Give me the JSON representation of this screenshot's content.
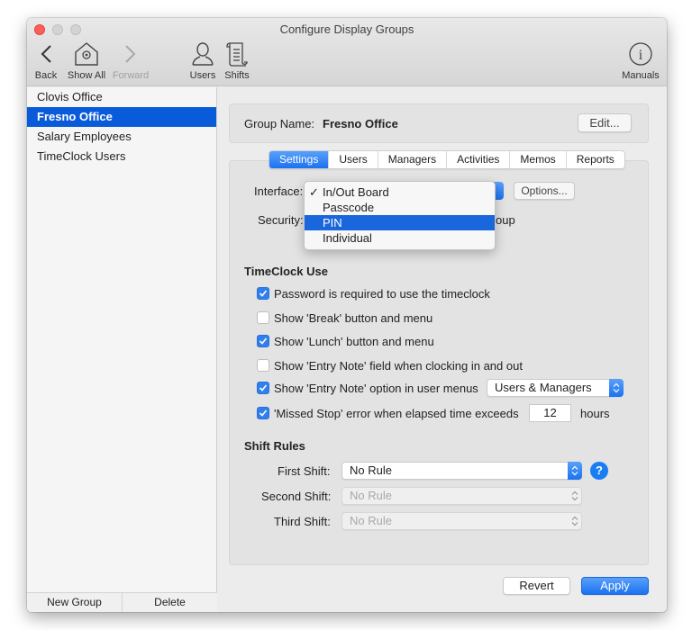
{
  "window": {
    "title": "Configure Display Groups"
  },
  "toolbar": {
    "back": "Back",
    "show_all": "Show All",
    "forward": "Forward",
    "users": "Users",
    "shifts": "Shifts",
    "manuals": "Manuals"
  },
  "sidebar": {
    "items": [
      {
        "label": "Clovis Office",
        "selected": false
      },
      {
        "label": "Fresno Office",
        "selected": true
      },
      {
        "label": "Salary Employees",
        "selected": false
      },
      {
        "label": "TimeClock Users",
        "selected": false
      }
    ],
    "new_group": "New Group",
    "delete": "Delete"
  },
  "group": {
    "label": "Group Name:",
    "value": "Fresno Office",
    "edit_button": "Edit..."
  },
  "tabs": [
    {
      "label": "Settings",
      "active": true
    },
    {
      "label": "Users",
      "active": false
    },
    {
      "label": "Managers",
      "active": false
    },
    {
      "label": "Activities",
      "active": false
    },
    {
      "label": "Memos",
      "active": false
    },
    {
      "label": "Reports",
      "active": false
    }
  ],
  "settings": {
    "interface_label": "Interface:",
    "options_button": "Options...",
    "security_label": "Security:",
    "security_value_tail": "oup",
    "interface_menu": {
      "items": [
        {
          "label": "In/Out Board",
          "checked": true,
          "highlighted": false
        },
        {
          "label": "Passcode",
          "checked": false,
          "highlighted": false
        },
        {
          "label": "PIN",
          "checked": false,
          "highlighted": true
        },
        {
          "label": "Individual",
          "checked": false,
          "highlighted": false
        }
      ],
      "check_glyph": "✓"
    },
    "timeclock_section": "TimeClock Use",
    "checkboxes": [
      {
        "label": "Password is required to use the timeclock",
        "checked": true
      },
      {
        "label": "Show 'Break' button and menu",
        "checked": false
      },
      {
        "label": "Show 'Lunch' button and menu",
        "checked": true
      },
      {
        "label": "Show 'Entry Note' field when clocking in and out",
        "checked": false
      },
      {
        "label": "Show 'Entry Note' option in user menus",
        "checked": true
      },
      {
        "label": "'Missed Stop' error when elapsed time exceeds",
        "checked": true
      }
    ],
    "entry_note_select": "Users & Managers",
    "missed_stop_hours": "12",
    "hours_label": "hours",
    "shift_section": "Shift Rules",
    "shifts": [
      {
        "label": "First Shift:",
        "value": "No Rule",
        "enabled": true
      },
      {
        "label": "Second Shift:",
        "value": "No Rule",
        "enabled": false
      },
      {
        "label": "Third Shift:",
        "value": "No Rule",
        "enabled": false
      }
    ],
    "help_glyph": "?"
  },
  "footer": {
    "revert": "Revert",
    "apply": "Apply"
  }
}
